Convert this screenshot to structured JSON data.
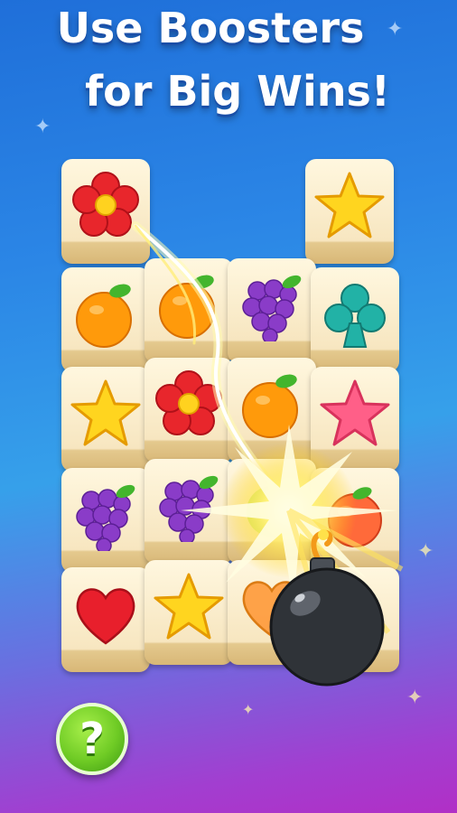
{
  "headline": {
    "line1": "Use Boosters",
    "line2": "for Big Wins!"
  },
  "help_button": {
    "label": "?"
  },
  "board": [
    {
      "id": "r1c1",
      "item": "flower-icon"
    },
    {
      "id": "r1c4",
      "item": "star-icon"
    },
    {
      "id": "r2c1",
      "item": "orange-icon"
    },
    {
      "id": "r2c2",
      "item": "orange-icon"
    },
    {
      "id": "r2c3",
      "item": "grapes-icon"
    },
    {
      "id": "r2c4",
      "item": "club-icon"
    },
    {
      "id": "r3c1",
      "item": "star-icon"
    },
    {
      "id": "r3c2",
      "item": "flower-icon"
    },
    {
      "id": "r3c3",
      "item": "orange-icon"
    },
    {
      "id": "r3c4",
      "item": "pink-star-icon"
    },
    {
      "id": "r4c1",
      "item": "grapes-icon"
    },
    {
      "id": "r4c2",
      "item": "grapes-icon"
    },
    {
      "id": "r4c3",
      "item": "blast-tile"
    },
    {
      "id": "r4c4",
      "item": "peach-icon"
    },
    {
      "id": "r5c1",
      "item": "heart-icon"
    },
    {
      "id": "r5c2",
      "item": "star-icon"
    },
    {
      "id": "r5c3",
      "item": "heart-icon"
    },
    {
      "id": "r5c4",
      "item": "covered-tile"
    }
  ],
  "colors": {
    "bg_top": "#1f6fd9",
    "bg_bottom": "#b12fc6",
    "tile_face": "#fff7df",
    "flower": "#e8262c",
    "star": "#ffd51f",
    "orange": "#ff9a0b",
    "grapes": "#8a3cc8",
    "club": "#22b2a6",
    "pink_star": "#ff5f88",
    "heart": "#e81f2c",
    "bomb": "#2f3338",
    "help_button": "#6fcb25"
  }
}
